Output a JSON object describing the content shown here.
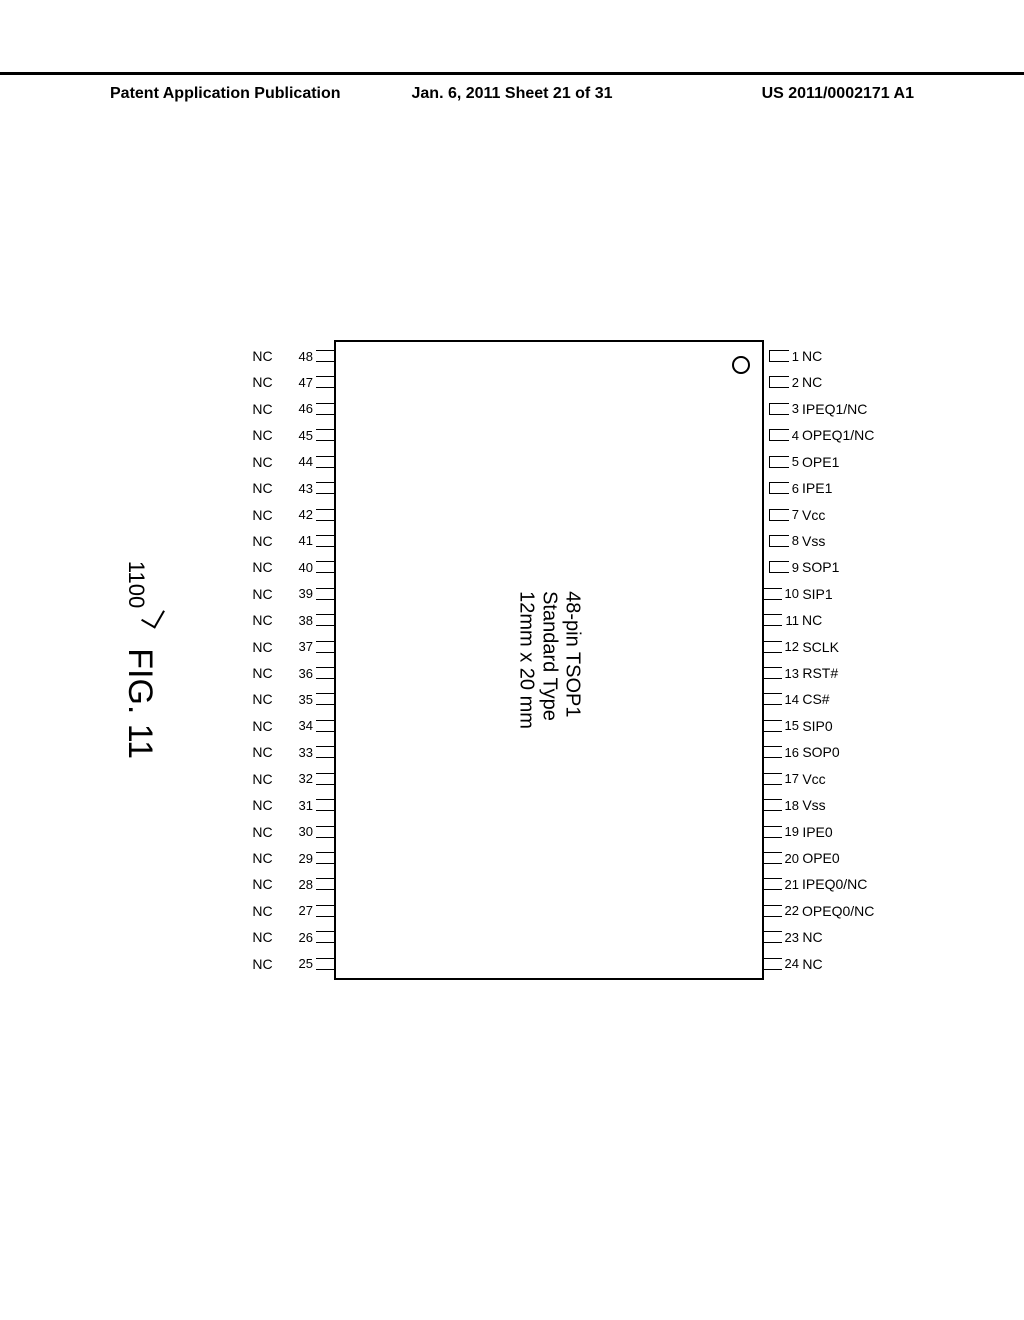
{
  "header": {
    "left": "Patent Application Publication",
    "mid": "Jan. 6, 2011  Sheet 21 of 31",
    "right": "US 2011/0002171 A1"
  },
  "chip": {
    "line1": "48-pin TSOP1",
    "line2": "Standard Type",
    "line3": "12mm x 20 mm"
  },
  "caption": {
    "ref": "1100",
    "label": "FIG. 11"
  },
  "pins_top": [
    {
      "n": "1",
      "l": "NC"
    },
    {
      "n": "2",
      "l": "NC"
    },
    {
      "n": "3",
      "l": "IPEQ1/NC"
    },
    {
      "n": "4",
      "l": "OPEQ1/NC"
    },
    {
      "n": "5",
      "l": "OPE1"
    },
    {
      "n": "6",
      "l": "IPE1"
    },
    {
      "n": "7",
      "l": "Vcc"
    },
    {
      "n": "8",
      "l": "Vss"
    },
    {
      "n": "9",
      "l": "SOP1"
    },
    {
      "n": "10",
      "l": "SIP1"
    },
    {
      "n": "11",
      "l": "NC"
    },
    {
      "n": "12",
      "l": "SCLK"
    },
    {
      "n": "13",
      "l": "RST#"
    },
    {
      "n": "14",
      "l": "CS#"
    },
    {
      "n": "15",
      "l": "SIP0"
    },
    {
      "n": "16",
      "l": "SOP0"
    },
    {
      "n": "17",
      "l": "Vcc"
    },
    {
      "n": "18",
      "l": "Vss"
    },
    {
      "n": "19",
      "l": "IPE0"
    },
    {
      "n": "20",
      "l": "OPE0"
    },
    {
      "n": "21",
      "l": "IPEQ0/NC"
    },
    {
      "n": "22",
      "l": "OPEQ0/NC"
    },
    {
      "n": "23",
      "l": "NC"
    },
    {
      "n": "24",
      "l": "NC"
    }
  ],
  "pins_bot": [
    {
      "n": "48",
      "l": "NC"
    },
    {
      "n": "47",
      "l": "NC"
    },
    {
      "n": "46",
      "l": "NC"
    },
    {
      "n": "45",
      "l": "NC"
    },
    {
      "n": "44",
      "l": "NC"
    },
    {
      "n": "43",
      "l": "NC"
    },
    {
      "n": "42",
      "l": "NC"
    },
    {
      "n": "41",
      "l": "NC"
    },
    {
      "n": "40",
      "l": "NC"
    },
    {
      "n": "39",
      "l": "NC"
    },
    {
      "n": "38",
      "l": "NC"
    },
    {
      "n": "37",
      "l": "NC"
    },
    {
      "n": "36",
      "l": "NC"
    },
    {
      "n": "35",
      "l": "NC"
    },
    {
      "n": "34",
      "l": "NC"
    },
    {
      "n": "33",
      "l": "NC"
    },
    {
      "n": "32",
      "l": "NC"
    },
    {
      "n": "31",
      "l": "NC"
    },
    {
      "n": "30",
      "l": "NC"
    },
    {
      "n": "29",
      "l": "NC"
    },
    {
      "n": "28",
      "l": "NC"
    },
    {
      "n": "27",
      "l": "NC"
    },
    {
      "n": "26",
      "l": "NC"
    },
    {
      "n": "25",
      "l": "NC"
    }
  ]
}
